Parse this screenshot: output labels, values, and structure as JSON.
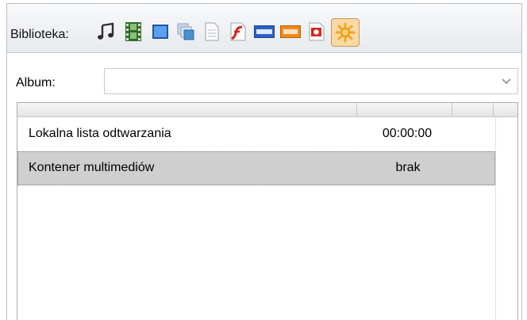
{
  "toolbar": {
    "label": "Biblioteka:",
    "icons": [
      {
        "name": "audio-icon",
        "color": "#2d2d2d"
      },
      {
        "name": "video-icon",
        "color": "#2f6b2a"
      },
      {
        "name": "image-icon",
        "color": "#3a7fd8"
      },
      {
        "name": "gallery-icon",
        "color": "#4a8fd0"
      },
      {
        "name": "document-icon",
        "color": "#9aa3ad"
      },
      {
        "name": "flash-icon",
        "color": "#d8241b"
      },
      {
        "name": "html-icon",
        "color": "#2c5fc4"
      },
      {
        "name": "rss-icon",
        "color": "#f08a1c"
      },
      {
        "name": "presentation-icon",
        "color": "#d8281d"
      },
      {
        "name": "multimedia-container-icon",
        "color": "#f5a623",
        "active": true
      }
    ]
  },
  "album": {
    "label": "Album:",
    "value": ""
  },
  "grid": {
    "columns": [
      "",
      "",
      "",
      ""
    ],
    "rows": [
      {
        "name": "Lokalna lista odtwarzania",
        "value": "00:00:00",
        "selected": false
      },
      {
        "name": "Kontener multimediów",
        "value": "brak",
        "selected": true
      }
    ]
  },
  "colors": {
    "selection": "#cfcfcf",
    "active_icon_bg": "#f9d9a4"
  }
}
